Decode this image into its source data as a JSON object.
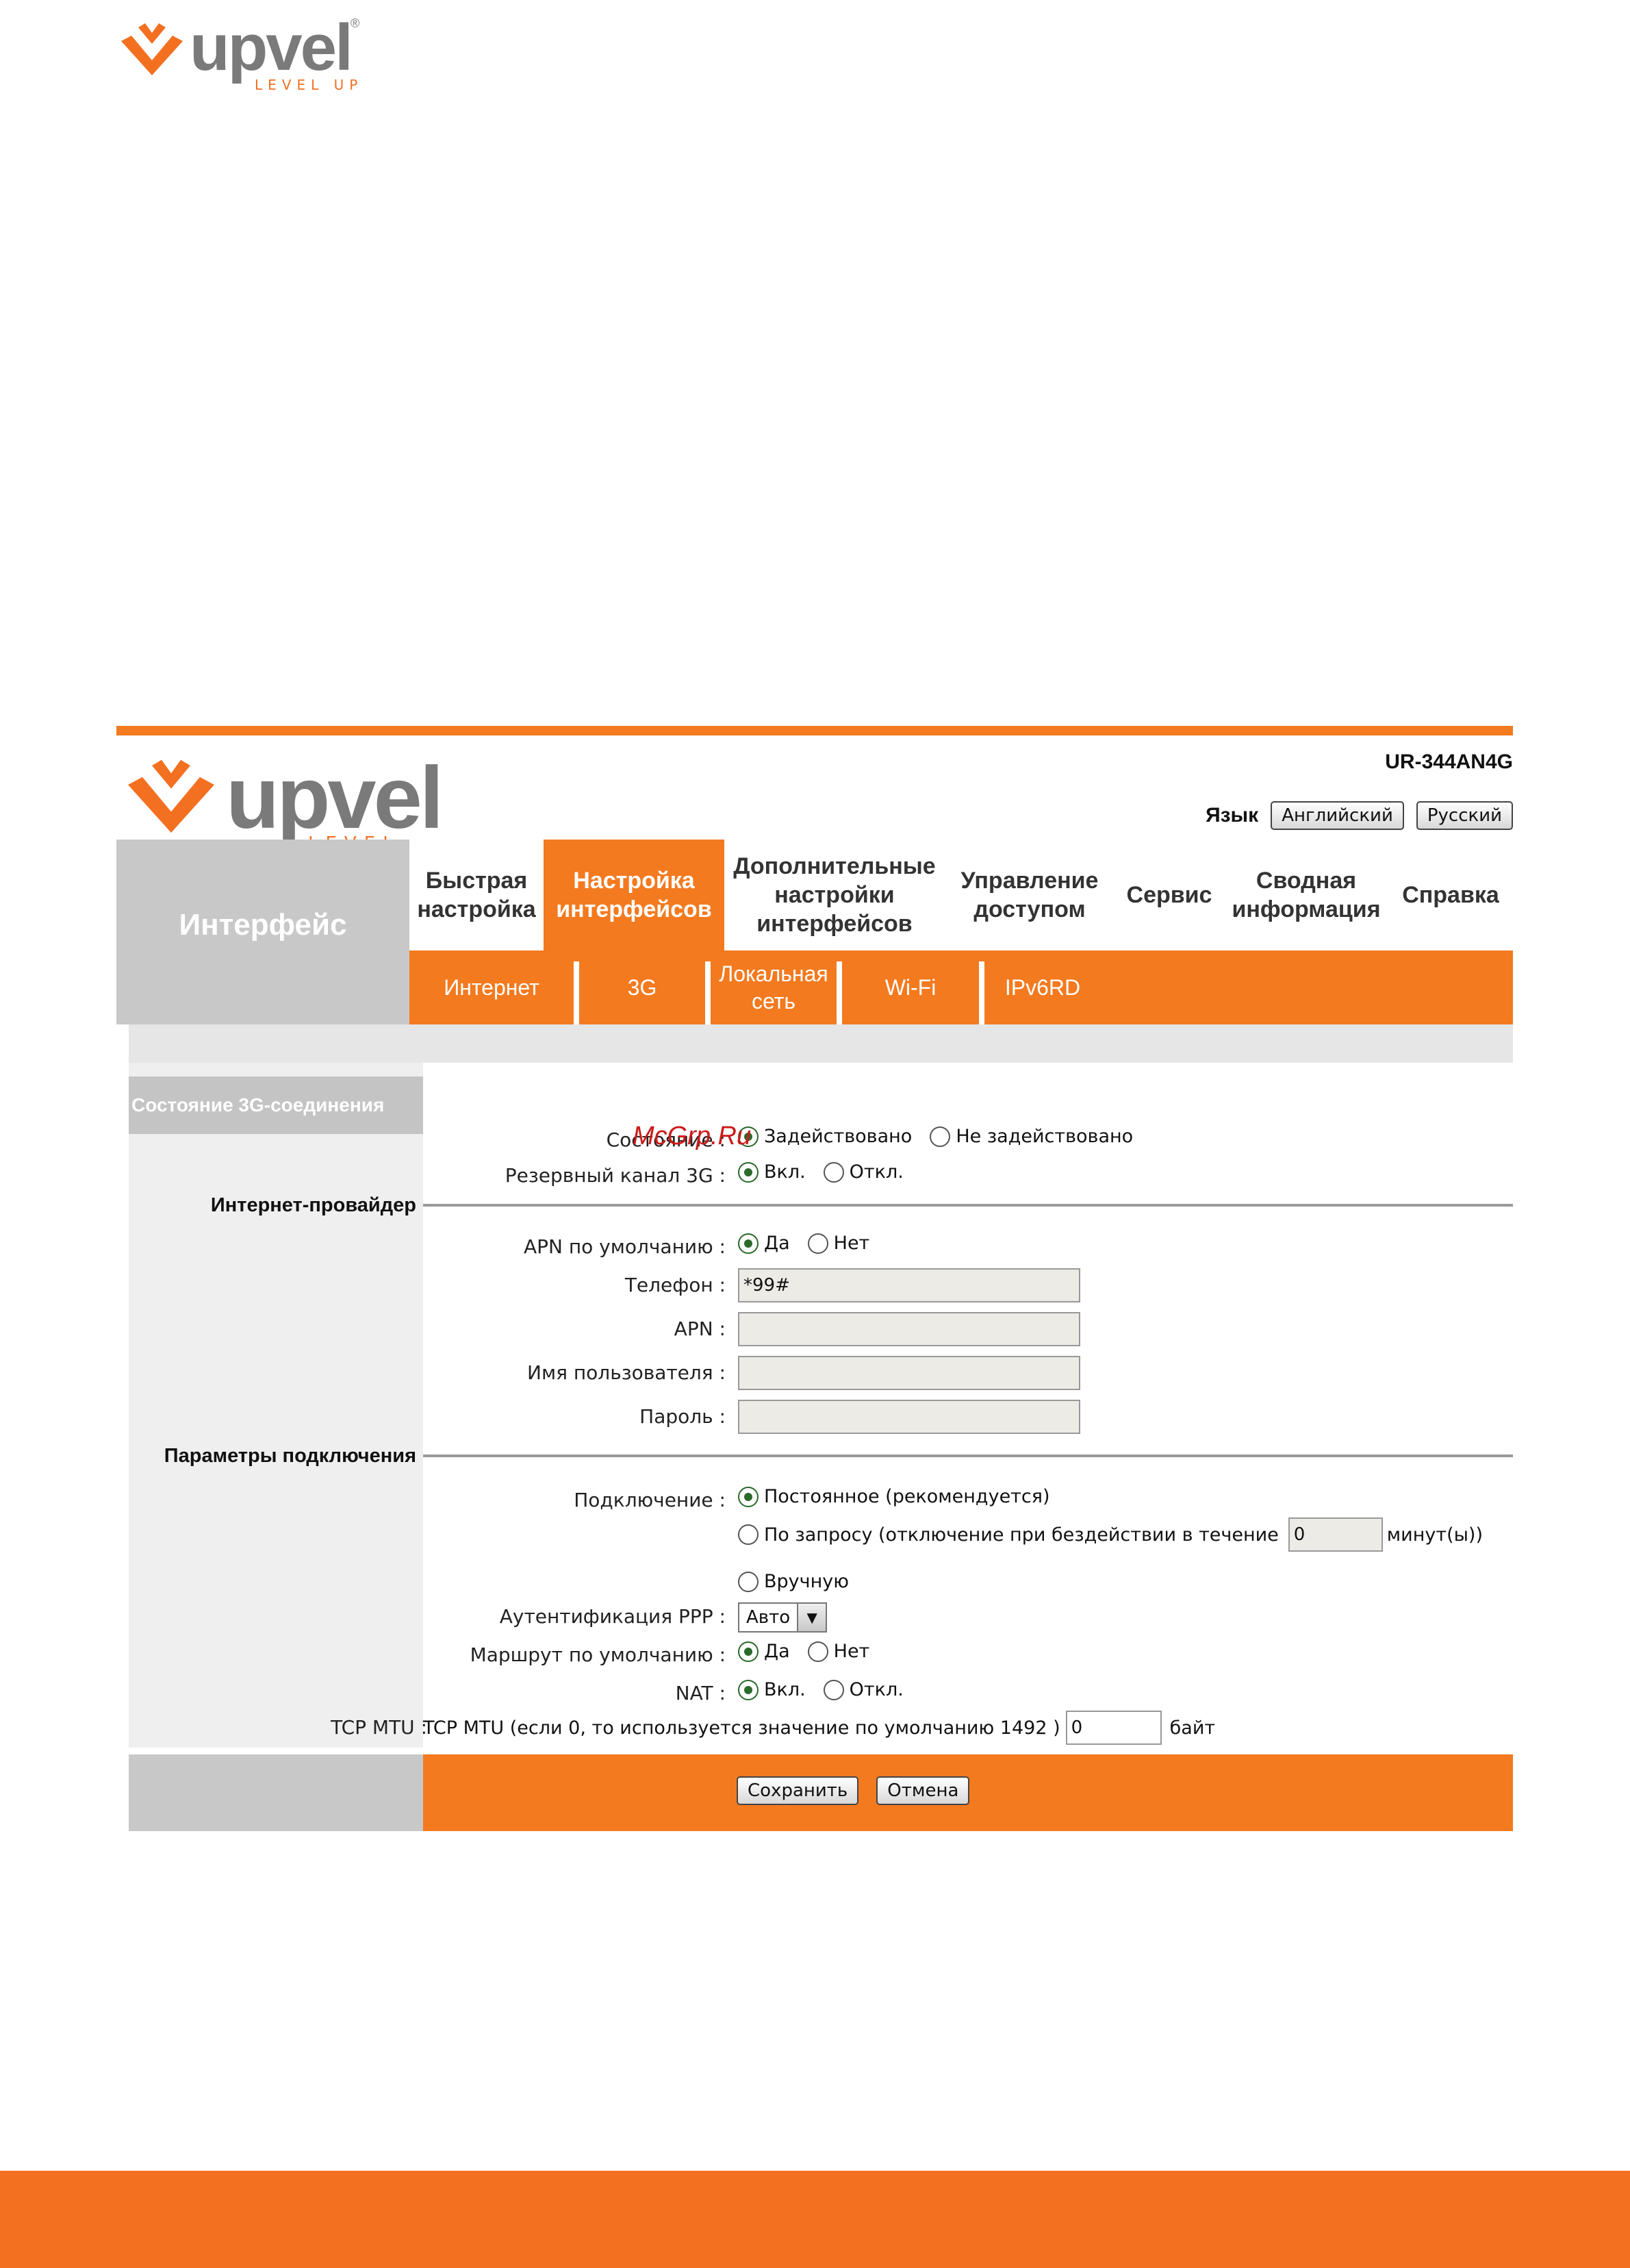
{
  "brand": {
    "name": "upvel",
    "tagline": "LEVEL UP",
    "reg": "®"
  },
  "header": {
    "model": "UR-344AN4G",
    "language_label": "Язык",
    "lang_en": "Английский",
    "lang_ru": "Русский"
  },
  "nav": {
    "section_title": "Интерфейс",
    "items": [
      {
        "label": "Быстрая\nнастройка"
      },
      {
        "label": "Настройка\nинтерфейсов"
      },
      {
        "label": "Дополнительные\nнастройки\nинтерфейсов"
      },
      {
        "label": "Управление\nдоступом"
      },
      {
        "label": "Сервис"
      },
      {
        "label": "Сводная\nинформация"
      },
      {
        "label": "Справка"
      }
    ],
    "sub_items": [
      {
        "label": "Интернет"
      },
      {
        "label": "3G"
      },
      {
        "label": "Локальная\nсеть"
      },
      {
        "label": "Wi-Fi"
      },
      {
        "label": "IPv6RD"
      }
    ]
  },
  "status_tab": "Состояние 3G-соединения",
  "sections": {
    "isp": "Интернет-провайдер",
    "connection": "Параметры подключения"
  },
  "form": {
    "state_label": "Состояние :",
    "state_on": "Задействовано",
    "state_off": "Не задействовано",
    "backup_label": "Резервный канал 3G :",
    "on": "Вкл.",
    "off": "Откл.",
    "apn_default_label": "APN по умолчанию :",
    "yes": "Да",
    "no": "Нет",
    "phone_label": "Телефон :",
    "phone_value": "*99#",
    "apn_label": "APN :",
    "user_label": "Имя пользователя :",
    "password_label": "Пароль :",
    "conn_label": "Подключение :",
    "conn_always": "Постоянное (рекомендуется)",
    "conn_demand": "По запросу (отключение при бездействии в течение",
    "conn_demand_value": "0",
    "conn_demand_unit": "минут(ы))",
    "conn_manual": "Вручную",
    "ppp_label": "Аутентификация PPP :",
    "ppp_value": "Авто",
    "route_label": "Маршрут по умолчанию :",
    "nat_label": "NAT :",
    "mtu_label": "TCP MTU :",
    "mtu_hint": "TCP MTU (если 0, то используется значение по умолчанию 1492 )",
    "mtu_value": "0",
    "mtu_unit": "байт"
  },
  "footer": {
    "save": "Сохранить",
    "cancel": "Отмена"
  },
  "watermark": "McGrp.Ru",
  "colors": {
    "accent": "#f37a1f",
    "gray": "#c8c8c8"
  }
}
